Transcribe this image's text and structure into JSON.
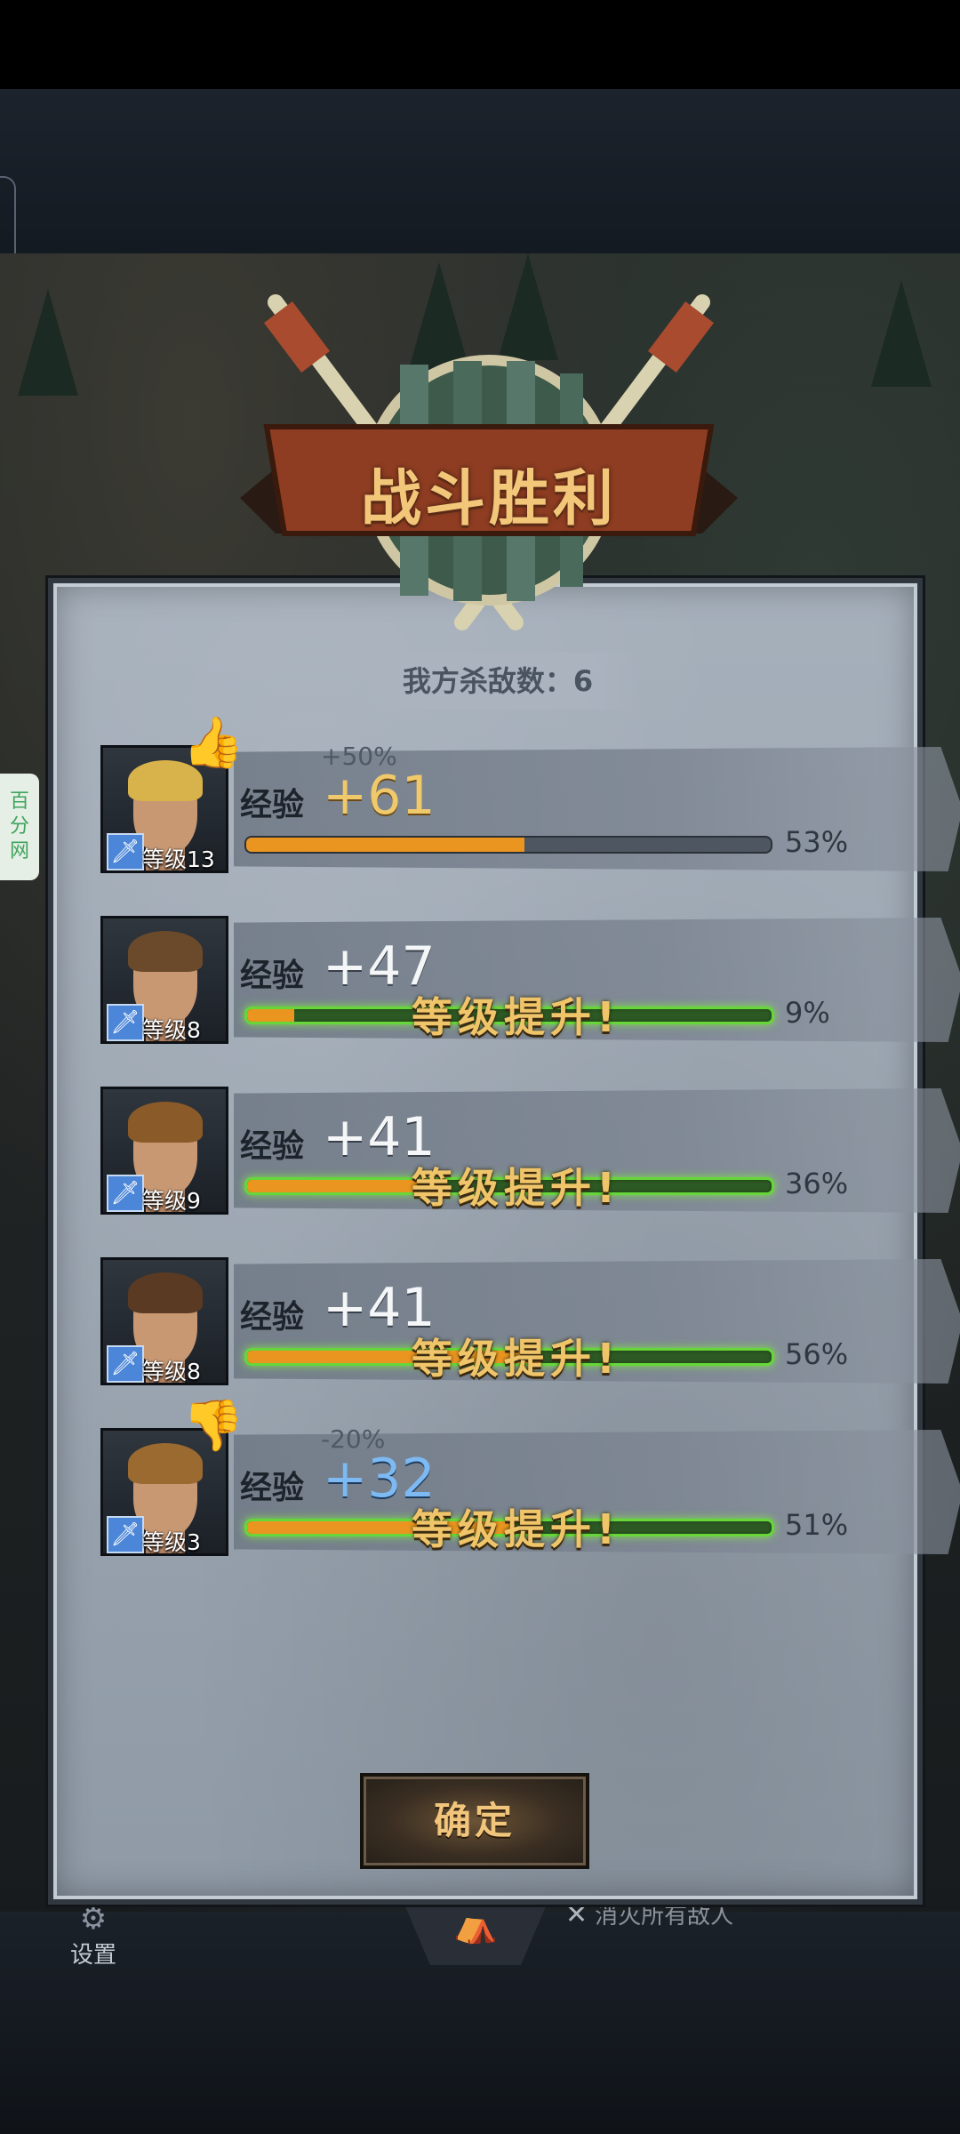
{
  "title": "战斗胜利",
  "kill_count": "我方杀敌数：6",
  "side_badge": [
    "百",
    "分",
    "网"
  ],
  "bottom_menu": {
    "settings_label": "设置",
    "quest_label": "消灭所有敌人"
  },
  "confirm_label": "确定",
  "exp_label": "经验",
  "level_up_text": "等级提升!",
  "heroes": [
    {
      "level": "等级13",
      "bonus": "+50%",
      "exp": "+61",
      "progress_pct": "53%",
      "progress": 0.53,
      "leveled_up": false,
      "mood": "thumbs-up",
      "hair": "#d8b24a"
    },
    {
      "level": "等级8",
      "bonus": "",
      "exp": "+47",
      "progress_pct": "9%",
      "progress": 0.09,
      "leveled_up": true,
      "mood": "",
      "hair": "#6b4a2c"
    },
    {
      "level": "等级9",
      "bonus": "",
      "exp": "+41",
      "progress_pct": "36%",
      "progress": 0.36,
      "leveled_up": true,
      "mood": "",
      "hair": "#8a5a28"
    },
    {
      "level": "等级8",
      "bonus": "",
      "exp": "+41",
      "progress_pct": "56%",
      "progress": 0.56,
      "leveled_up": true,
      "mood": "",
      "hair": "#5a3a22"
    },
    {
      "level": "等级3",
      "bonus": "-20%",
      "exp": "+32",
      "progress_pct": "51%",
      "progress": 0.51,
      "leveled_up": true,
      "mood": "thumbs-down",
      "hair": "#9a6a30"
    }
  ],
  "colors": {
    "gold_text": "#f0c96c",
    "exp_fill": "#e9951f",
    "level_up_glow": "#66d63a",
    "penalty_blue": "#7db9f2"
  }
}
